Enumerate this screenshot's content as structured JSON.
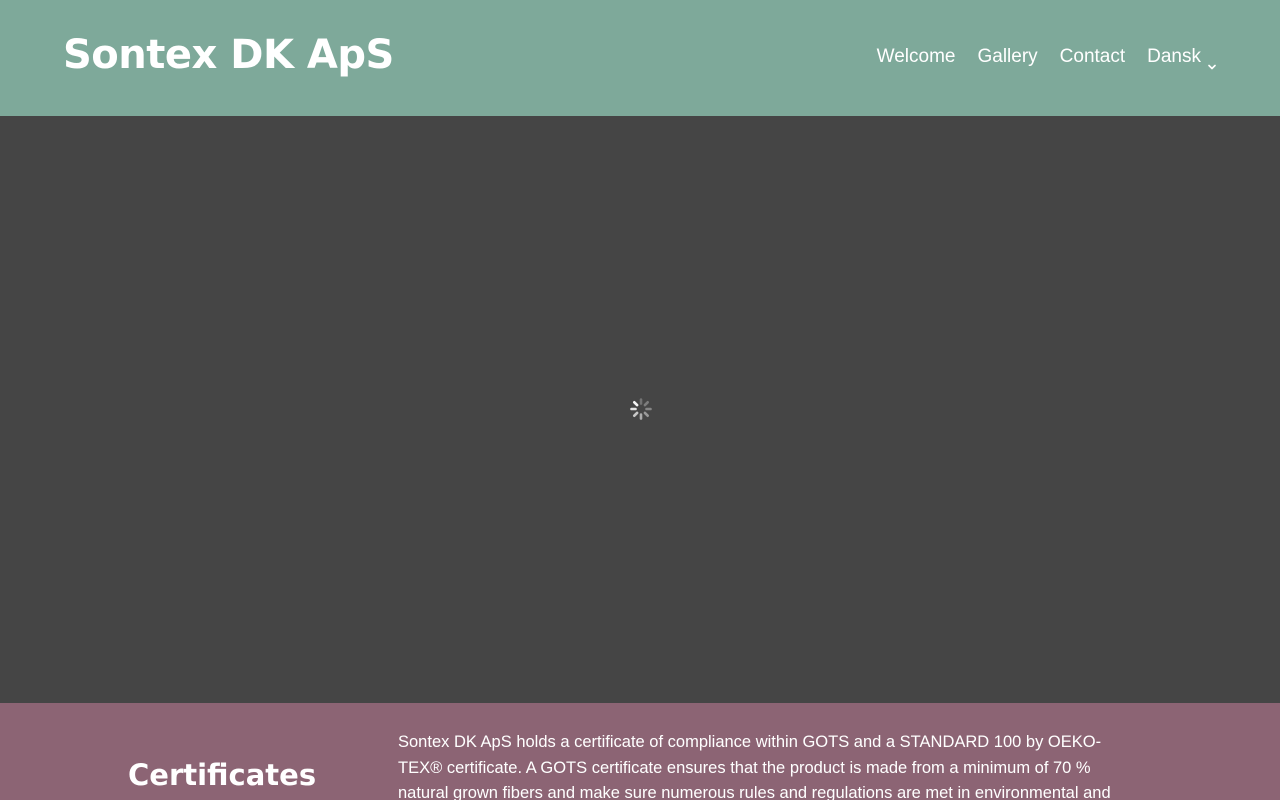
{
  "header": {
    "brand": "Sontex DK ApS",
    "background_color": "#7ea99a",
    "nav": [
      {
        "label": "Welcome"
      },
      {
        "label": "Gallery"
      },
      {
        "label": "Contact"
      },
      {
        "label": "Dansk",
        "icon": "chevron-down-icon"
      }
    ]
  },
  "hero": {
    "background_color": "#454545",
    "icon": "loading-spinner-icon"
  },
  "certificates": {
    "background_color": "#8c6474",
    "title": "Certificates",
    "text": "Sontex DK ApS holds a certificate of compliance within GOTS and a STANDARD 100 by OEKO-TEX® certificate. A GOTS certificate ensures that the product is made from a minimum of 70 % natural grown fibers and make sure numerous rules and regulations are met in environmental and social"
  }
}
